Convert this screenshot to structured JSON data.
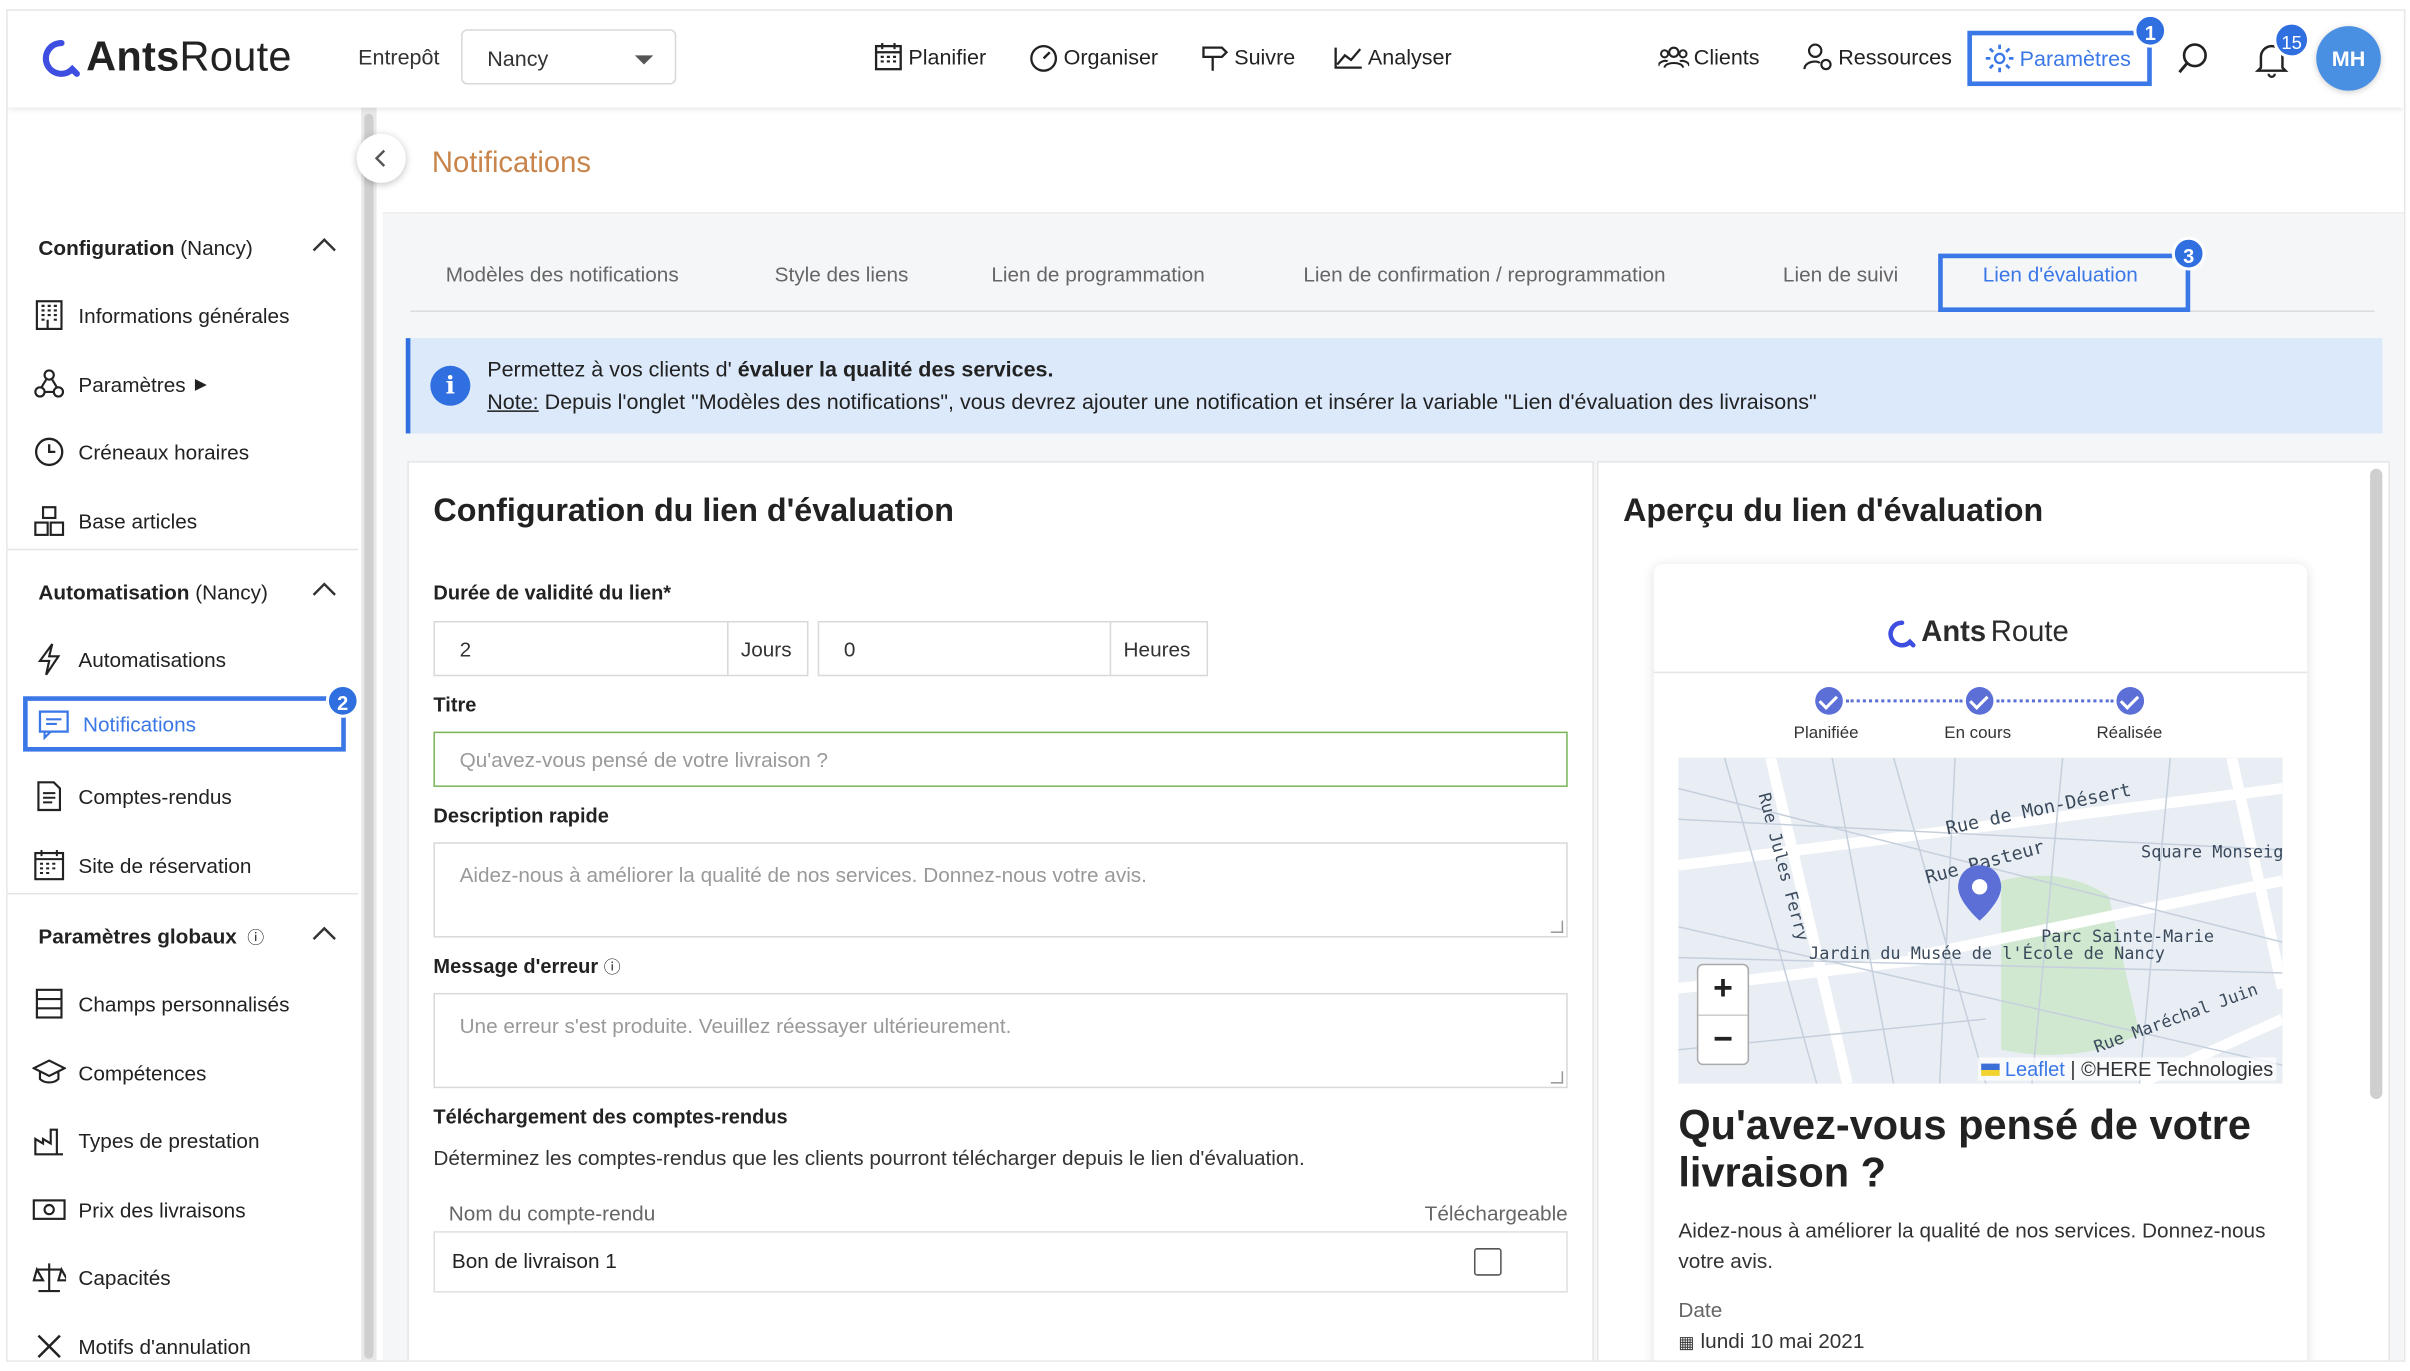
{
  "app": {
    "brand_a": "Ants",
    "brand_b": "Route"
  },
  "header": {
    "warehouse_label": "Entrepôt",
    "warehouse_value": "Nancy",
    "nav": [
      "Planifier",
      "Organiser",
      "Suivre",
      "Analyser"
    ],
    "nav_right": [
      "Clients",
      "Ressources",
      "Paramètres"
    ],
    "notif_count": "15",
    "avatar": "MH",
    "step_badges": [
      "1",
      "2",
      "3"
    ]
  },
  "sidebar": {
    "sections": [
      {
        "title": "Configuration",
        "suffix": " (Nancy)"
      },
      {
        "title": "Automatisation",
        "suffix": " (Nancy)"
      },
      {
        "title": "Paramètres globaux",
        "suffix": ""
      }
    ],
    "items": [
      "Informations générales",
      "Paramètres",
      "Créneaux horaires",
      "Base articles",
      "Automatisations",
      "Notifications",
      "Comptes-rendus",
      "Site de réservation",
      "Champs personnalisés",
      "Compétences",
      "Types de prestation",
      "Prix des livraisons",
      "Capacités",
      "Motifs d'annulation"
    ]
  },
  "page": {
    "title": "Notifications",
    "tabs": [
      "Modèles des notifications",
      "Style des liens",
      "Lien de programmation",
      "Lien de confirmation / reprogrammation",
      "Lien de suivi",
      "Lien d'évaluation"
    ],
    "active_tab": "Lien d'évaluation"
  },
  "info": {
    "l1_pre": "Permettez à vos clients d' ",
    "l1_bold": "évaluer la qualité des services.",
    "l2_note": "Note:",
    "l2_text": " Depuis l'onglet \"Modèles des notifications\", vous devrez ajouter une notification et insérer la variable \"Lien d'évaluation des livraisons\""
  },
  "config": {
    "title": "Configuration du lien d'évaluation",
    "validity_label": "Durée de validité du lien*",
    "days_value": "2",
    "days_unit": "Jours",
    "hours_value": "0",
    "hours_unit": "Heures",
    "title_label": "Titre",
    "title_placeholder": "Qu'avez-vous pensé de votre livraison ?",
    "desc_label": "Description rapide",
    "desc_placeholder": "Aidez-nous à améliorer la qualité de nos services. Donnez-nous votre avis.",
    "error_label": "Message d'erreur",
    "error_placeholder": "Une erreur s'est produite. Veuillez réessayer ultérieurement.",
    "download_label": "Téléchargement des comptes-rendus",
    "download_desc": "Déterminez les comptes-rendus que les clients pourront télécharger depuis le lien d'évaluation.",
    "col_name": "Nom du compte-rendu",
    "col_download": "Téléchargeable",
    "rows": [
      {
        "name": "Bon de livraison 1",
        "checked": false
      }
    ]
  },
  "preview": {
    "title": "Aperçu du lien d'évaluation",
    "steps": [
      "Planifiée",
      "En cours",
      "Réalisée"
    ],
    "map_labels": [
      "Rue de Mon-Désert",
      "Rue Pasteur",
      "Square Monseigneur Petit",
      "Rue Jules Ferry",
      "Parc Sainte-Marie",
      "Jardin du Musée de l'École de Nancy",
      "Rue Maréchal Juin"
    ],
    "zoom_in": "+",
    "zoom_out": "−",
    "attribution_link": "Leaflet",
    "attribution_rest": " | ©HERE Technologies",
    "card_title": "Qu'avez-vous pensé de votre livraison ?",
    "card_desc": "Aidez-nous à améliorer la qualité de nos services. Donnez-nous votre avis.",
    "date_label": "Date",
    "date_value": "lundi 10 mai 2021"
  },
  "colors": {
    "accent": "#3b78e7",
    "title_orange": "#c8844a",
    "info_bg": "#dbe9fb",
    "step_purple": "#5b6fd6"
  }
}
